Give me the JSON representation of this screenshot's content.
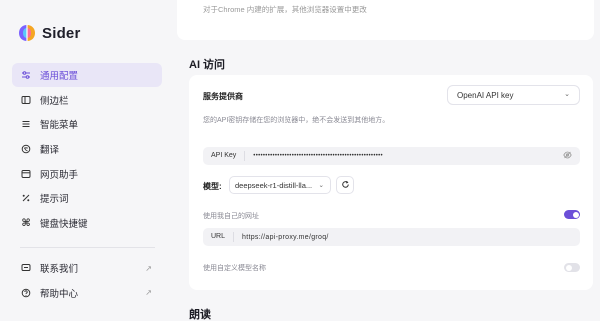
{
  "app": {
    "name": "Sider"
  },
  "sidebar": {
    "items": [
      {
        "label": "通用配置",
        "icon": "sliders-icon",
        "active": true
      },
      {
        "label": "侧边栏",
        "icon": "sidebar-icon"
      },
      {
        "label": "智能菜单",
        "icon": "menu-icon"
      },
      {
        "label": "翻译",
        "icon": "translate-icon"
      },
      {
        "label": "网页助手",
        "icon": "webpage-icon"
      },
      {
        "label": "提示词",
        "icon": "percent-icon"
      },
      {
        "label": "键盘快捷键",
        "icon": "command-icon"
      }
    ],
    "footer_items": [
      {
        "label": "联系我们",
        "icon": "message-icon",
        "external": "↗"
      },
      {
        "label": "帮助中心",
        "icon": "help-icon",
        "external": "↗"
      }
    ]
  },
  "top_card": {
    "text": "对于Chrome 内建的扩展，其他浏览器设置中更改"
  },
  "ai_access": {
    "title": "AI 访问",
    "provider": {
      "label": "服务提供商",
      "hint": "您的API密钥存储在您的浏览器中，绝不会发送到其他地方。",
      "selected": "OpenAI API key"
    },
    "api_key": {
      "label": "API Key",
      "value": "••••••••••••••••••••••••••••••••••••••••••••••••••••••"
    },
    "model": {
      "label": "模型:",
      "selected": "deepseek-r1-distill-lla..."
    },
    "custom_url": {
      "label": "使用我自己的网址",
      "enabled": true,
      "url_label": "URL",
      "url_value": "https://api-proxy.me/groq/"
    },
    "custom_model_name": {
      "label": "使用自定义模型名称",
      "enabled": false
    }
  },
  "reading": {
    "title": "朗读"
  },
  "colors": {
    "accent": "#6b4fd8",
    "active_bg": "#e9e6f7"
  }
}
